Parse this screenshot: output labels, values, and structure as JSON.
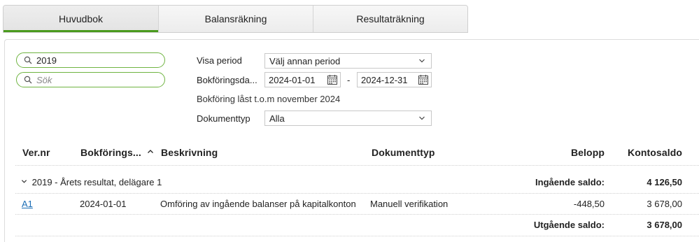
{
  "tabs": [
    {
      "label": "Huvudbok",
      "active": true
    },
    {
      "label": "Balansräkning",
      "active": false
    },
    {
      "label": "Resultaträkning",
      "active": false
    }
  ],
  "search": {
    "year_value": "2019",
    "placeholder": "Sök"
  },
  "filters": {
    "period_label": "Visa period",
    "period_value": "Välj annan period",
    "date_label": "Bokföringsda...",
    "date_from": "2024-01-01",
    "date_separator": "-",
    "date_to": "2024-12-31",
    "locked_text": "Bokföring låst t.o.m november 2024",
    "doctype_label": "Dokumenttyp",
    "doctype_value": "Alla"
  },
  "table": {
    "headers": {
      "vernr": "Ver.nr",
      "date": "Bokförings...",
      "desc": "Beskrivning",
      "doctype": "Dokumenttyp",
      "amount": "Belopp",
      "balance": "Kontosaldo"
    },
    "sort": {
      "column": "date",
      "direction": "ascending"
    },
    "group": {
      "label": "2019 - Årets resultat, delägare 1",
      "opening_label": "Ingående saldo:",
      "opening_value": "4 126,50",
      "closing_label": "Utgående saldo:",
      "closing_value": "3 678,00"
    },
    "rows": [
      {
        "vernr": "A1",
        "date": "2024-01-01",
        "desc": "Omföring av ingående balanser på kapitalkonton",
        "doctype": "Manuell verifikation",
        "amount": "-448,50",
        "balance": "3 678,00"
      }
    ]
  },
  "colors": {
    "accent": "#4a9a1e",
    "pill_border": "#6fb441",
    "link": "#1a6db5"
  }
}
